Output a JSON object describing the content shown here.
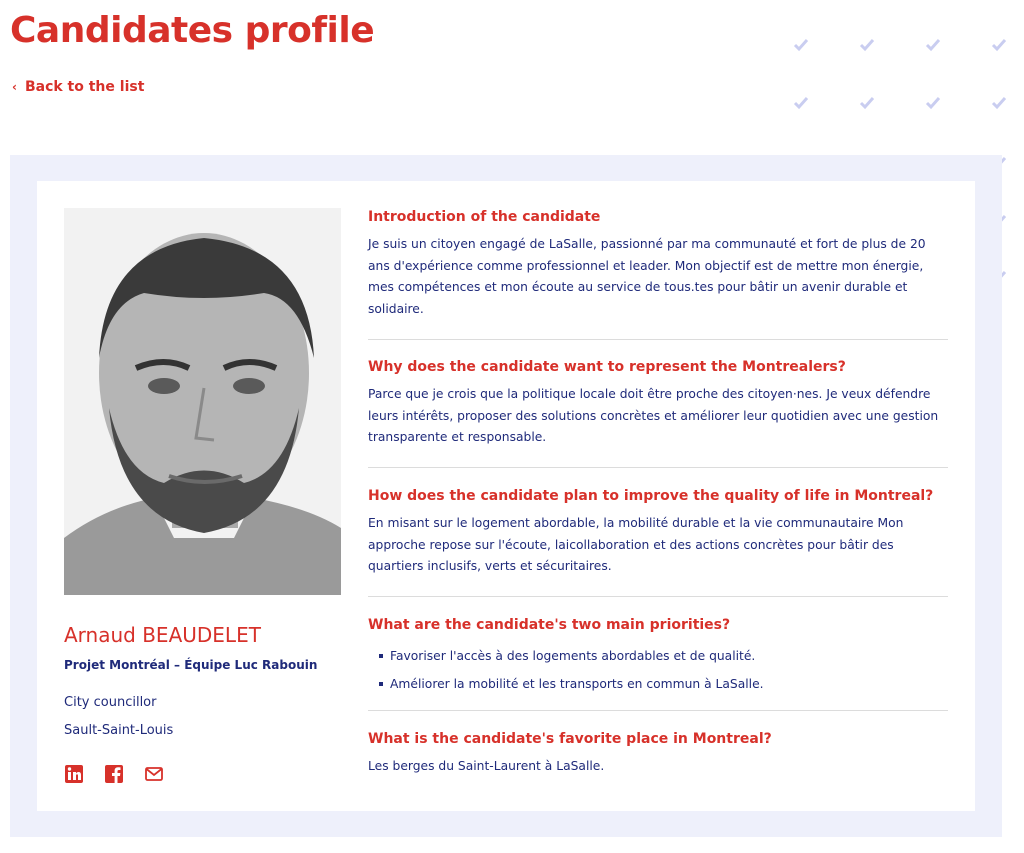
{
  "page": {
    "title": "Candidates profile",
    "back_label": "Back to the list"
  },
  "candidate": {
    "name": "Arnaud BEAUDELET",
    "party": "Projet Montréal – Équipe Luc Rabouin",
    "role": "City councillor",
    "district": "Sault-Saint-Louis"
  },
  "sections": [
    {
      "question": "Introduction of the candidate",
      "answer": "Je suis un citoyen engagé de LaSalle, passionné par ma communauté et fort de plus de 20 ans d'expérience comme professionnel et leader. Mon objectif est de mettre mon énergie, mes compétences et mon écoute au service de tous.tes pour bâtir un avenir durable et solidaire."
    },
    {
      "question": "Why does the candidate want to represent the Montrealers?",
      "answer": "Parce que je crois que la politique locale doit être proche des citoyen·nes. Je veux défendre leurs intérêts, proposer des solutions concrètes et améliorer leur quotidien avec une gestion transparente et responsable."
    },
    {
      "question": "How does the candidate plan to improve the quality of life in Montreal?",
      "answer": "En misant sur le logement abordable, la mobilité durable et la vie communautaire Mon approche repose sur l'écoute, laicollaboration et des actions concrètes pour bâtir des quartiers inclusifs, verts et sécuritaires."
    },
    {
      "question": "What are the candidate's two main priorities?",
      "items": [
        "Favoriser l'accès à des logements abordables et de qualité.",
        "Améliorer la mobilité et les transports en commun à LaSalle."
      ]
    },
    {
      "question": "What is the candidate's favorite place in Montreal?",
      "answer": "Les berges du Saint-Laurent à LaSalle."
    }
  ],
  "socials": [
    "linkedin-icon",
    "facebook-icon",
    "email-icon"
  ],
  "colors": {
    "accent": "#d7312a",
    "text": "#1f2a7a",
    "panel": "#eef0fb",
    "checks": "#c9cdf0"
  }
}
